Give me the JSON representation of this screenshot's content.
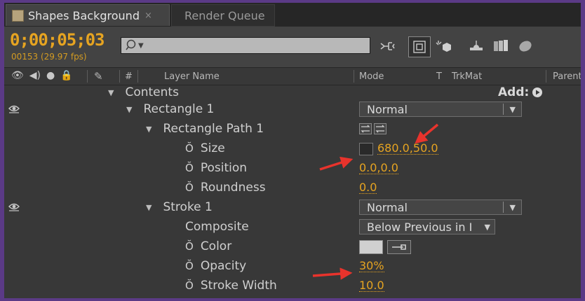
{
  "tabs": [
    {
      "label": "Shapes Background",
      "close": "×"
    },
    {
      "label": "Render Queue"
    }
  ],
  "toolbar": {
    "timecode": "0;00;05;03",
    "frame_info": "00153 (29.97 fps)",
    "search": {
      "value": "",
      "placeholder": ""
    },
    "icons": [
      "comp-flowchart-icon",
      "draft-3d-icon",
      "shy-layers-icon",
      "frame-blending-icon",
      "motion-blur-icon",
      "graph-editor-icon"
    ]
  },
  "columns": {
    "hash": "#",
    "layer_name": "Layer Name",
    "mode": "Mode",
    "t": "T",
    "trkmat": "TrkMat",
    "parent": "Parent"
  },
  "rows": {
    "contents": {
      "label": "Contents",
      "add_label": "Add:"
    },
    "rect1": {
      "label": "Rectangle 1",
      "mode": "Normal"
    },
    "rectpath": {
      "label": "Rectangle Path 1"
    },
    "size": {
      "label": "Size",
      "value": "680.0,50.0"
    },
    "position": {
      "label": "Position",
      "value": "0.0,0.0"
    },
    "roundness": {
      "label": "Roundness",
      "value": "0.0"
    },
    "stroke": {
      "label": "Stroke 1",
      "mode": "Normal"
    },
    "composite": {
      "label": "Composite",
      "value": "Below Previous in I"
    },
    "color": {
      "label": "Color",
      "swatch": "#d0d0d0"
    },
    "opacity": {
      "label": "Opacity",
      "value": "30%"
    },
    "strokewidth": {
      "label": "Stroke Width",
      "value": "10.0"
    }
  },
  "colors": {
    "accent": "#e6a421",
    "annotation_arrow": "#e8332c",
    "frame": "#5b3a86"
  }
}
